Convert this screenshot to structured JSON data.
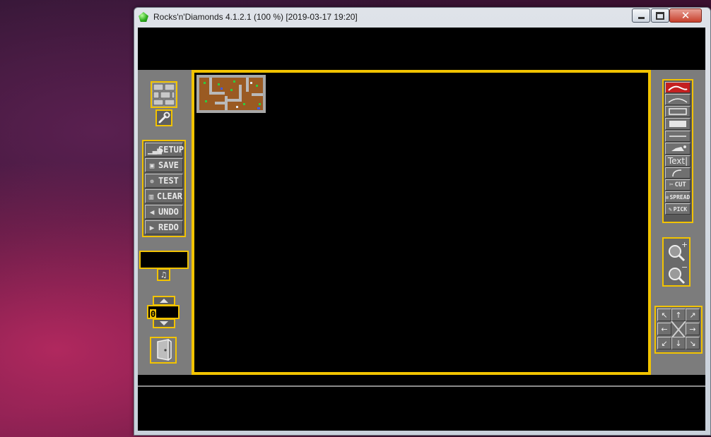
{
  "window": {
    "title": "Rocks'n'Diamonds 4.1.2.1 (100 %) [2019-03-17 19:20]",
    "minimize_glyph": "",
    "maximize_glyph": "",
    "close_glyph": "✕"
  },
  "editor": {
    "controls": [
      {
        "icon": "signal-bars-icon",
        "glyph": "▁▃▅",
        "label": "SETUP"
      },
      {
        "icon": "floppy-disk-icon",
        "glyph": "▣",
        "label": "SAVE"
      },
      {
        "icon": "running-man-icon",
        "glyph": "✵",
        "label": "TEST"
      },
      {
        "icon": "trash-can-icon",
        "glyph": "▥",
        "label": "CLEAR"
      },
      {
        "icon": "undo-arrow-icon",
        "glyph": "◀",
        "label": "UNDO"
      },
      {
        "icon": "redo-arrow-icon",
        "glyph": "▶",
        "label": "REDO"
      }
    ],
    "level_number": "0",
    "music_glyph": "♫",
    "draw_tools": [
      {
        "name": "freehand-tool",
        "label": ""
      },
      {
        "name": "line-tool",
        "label": ""
      },
      {
        "name": "rectangle-tool",
        "label": ""
      },
      {
        "name": "filled-box-tool",
        "label": ""
      },
      {
        "name": "straight-line-tool",
        "label": ""
      },
      {
        "name": "flood-fill-tool",
        "label": ""
      },
      {
        "name": "text-tool",
        "label": "Text|"
      },
      {
        "name": "arc-tool",
        "label": ""
      },
      {
        "name": "cut-tool",
        "label": "CUT"
      },
      {
        "name": "spread-tool",
        "label": "SPREAD"
      },
      {
        "name": "pick-tool",
        "label": "PICK"
      }
    ],
    "zoom_in_glyph": "+",
    "zoom_out_glyph": "−",
    "scroll_arrows": [
      "↖",
      "↑",
      "↗",
      "←",
      "→",
      "↙",
      "↓",
      "↘"
    ],
    "colors": {
      "frame": "#f2c300",
      "panel": "#7c7c7c",
      "playfield": "#000000"
    }
  }
}
